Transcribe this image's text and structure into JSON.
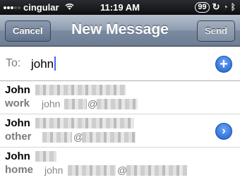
{
  "status_bar": {
    "carrier": "cingular",
    "time": "11:19 AM",
    "badge": "99"
  },
  "nav": {
    "cancel_label": "Cancel",
    "title": "New Message",
    "send_label": "Send"
  },
  "to_field": {
    "label": "To:",
    "value": "john"
  },
  "results": [
    {
      "name": "John",
      "label": "work",
      "detail": "john",
      "at": "@"
    },
    {
      "name": "John",
      "label": "other",
      "detail": "",
      "at": "@"
    },
    {
      "name": "John",
      "label": "home",
      "detail": "john",
      "at": "@"
    }
  ]
}
